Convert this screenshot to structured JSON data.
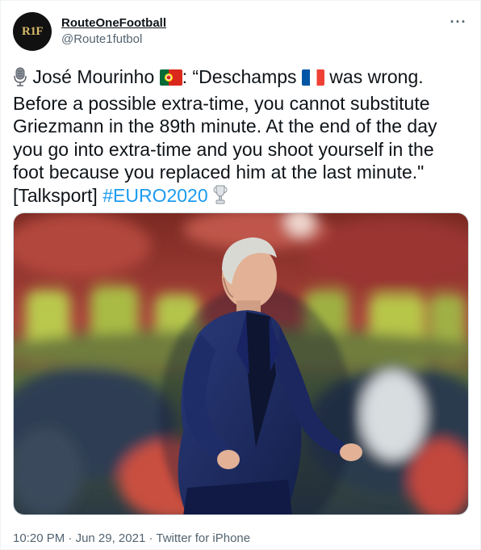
{
  "account": {
    "avatar_text": "R1F",
    "display_name": "RouteOneFootball",
    "handle": "@Route1futbol"
  },
  "menu": {
    "more_label": "···"
  },
  "tweet": {
    "line_1a": " José Mourinho ",
    "line_1b": ": “Deschamps ",
    "line_1c": " was wrong.",
    "line_2": "Before a possible extra-time, you cannot substitute",
    "line_3": "Griezmann in the 89th minute. At the end of the day",
    "line_4": "you go into extra-time and you shoot yourself in the",
    "line_5": "foot because you replaced him at the last minute.\"",
    "line_6a": "[Talksport] ",
    "hashtag": "#EURO2020"
  },
  "icons": [
    "microphone-icon",
    "portugal-flag-icon",
    "france-flag-icon",
    "trophy-icon",
    "more-icon"
  ],
  "meta": {
    "time": "10:20 PM",
    "separator_1": " · ",
    "date": "Jun 29, 2021",
    "separator_2": " · ",
    "source": "Twitter for iPhone"
  },
  "colors": {
    "link": "#1d9bf0",
    "secondary_text": "#536471",
    "primary_text": "#0f1419"
  }
}
